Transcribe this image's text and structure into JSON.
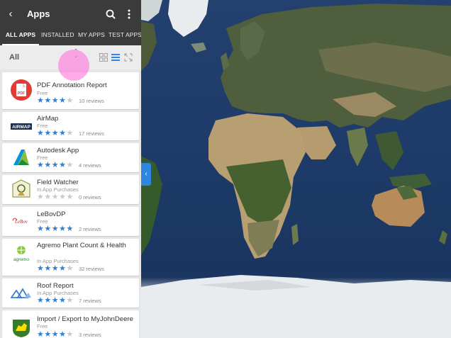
{
  "header": {
    "title": "Apps",
    "back_icon": "back-arrow-icon",
    "search_icon": "search-icon",
    "more_icon": "more-vertical-icon"
  },
  "tabs": [
    {
      "label": "ALL APPS",
      "active": true
    },
    {
      "label": "INSTALLED",
      "active": false
    },
    {
      "label": "MY APPS",
      "active": false
    },
    {
      "label": "TEST APPS",
      "active": false
    }
  ],
  "filter": {
    "label": "All",
    "sort_icon": "sort-icon",
    "view_modes": [
      "grid-view-icon",
      "list-view-icon",
      "expand-icon"
    ],
    "active_view": "list-view-icon"
  },
  "apps": [
    {
      "name": "PDF Annotation Report",
      "price": "Free",
      "rating": 4,
      "reviews": "10 reviews",
      "icon": "pdf-icon"
    },
    {
      "name": "AirMap",
      "price": "Free",
      "rating": 4,
      "reviews": "17 reviews",
      "icon": "airmap-logo"
    },
    {
      "name": "Autodesk App",
      "price": "Free",
      "rating": 4,
      "reviews": "4 reviews",
      "icon": "autodesk-logo"
    },
    {
      "name": "Field Watcher",
      "price": "In App Purchases",
      "rating": 0,
      "reviews": "0 reviews",
      "icon": "field-watcher-logo"
    },
    {
      "name": "LeBovDP",
      "price": "Free",
      "rating": 5,
      "reviews": "2 reviews",
      "icon": "lebov-logo"
    },
    {
      "name": "Agremo Plant Count & Health",
      "price": "In App Purchases",
      "rating": 4,
      "reviews": "32 reviews",
      "icon": "agremo-logo"
    },
    {
      "name": "Roof Report",
      "price": "In App Purchases",
      "rating": 4,
      "reviews": "7 reviews",
      "icon": "roof-report-logo"
    },
    {
      "name": "Import / Export to MyJohnDeere",
      "price": "Free",
      "rating": 4,
      "reviews": "3 reviews",
      "icon": "john-deere-logo"
    }
  ],
  "logo_text": {
    "pdf": "PDF",
    "airmap": "AIRMAP",
    "lebov": "LeBov",
    "agremo": "agremo"
  },
  "colors": {
    "appbar": "#3b3b3b",
    "star_filled": "#2f7fd6",
    "star_empty": "#c9c9c9",
    "accent": "#2f86e0"
  },
  "map": {
    "type": "satellite world map"
  }
}
